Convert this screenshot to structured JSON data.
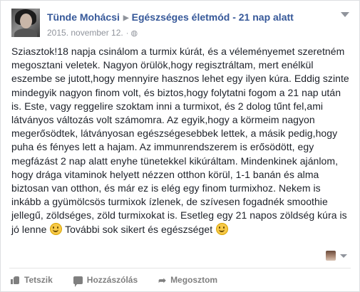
{
  "post": {
    "author": "Tünde Mohácsi",
    "target": "Egészséges életmód - 21 nap alatt",
    "date": "2015. november 12.",
    "privacy_icon": "globe-icon",
    "text_lines": [
      "Sziasztok!18 napja csinálom a turmix kúrát, és a véleményemet szeretném",
      "megosztani veletek. Nagyon örülök,hogy regisztráltam, mert enélkül",
      "eszembe se jutott,hogy mennyire hasznos lehet egy ilyen kúra. Eddig szinte",
      "mindegyik nagyon finom volt, és biztos,hogy folytatni fogom a 21 nap után",
      "is. Este, vagy reggelire szoktam inni a turmixot, és 2 dolog tűnt fel,ami",
      "látványos változás volt számomra. Az egyik,hogy a körmeim nagyon",
      "megerősödtek, látványosan egészségesebbek lettek, a másik pedig,hogy",
      "puha és fényes lett a hajam. Az immunrendszerem is erősödött, egy",
      "megfázást 2 nap alatt enyhe tünetekkel kikúráltam. Mindenkinek ajánlom,",
      "hogy drága vitaminok helyett nézzen otthon körül, 1-1 banán és alma",
      "biztosan van otthon, és már ez is elég egy finom turmixhoz. Nekem is",
      "inkább a gyümölcsös turmixok ízlenek, de szívesen fogadnék smoothie",
      "jellegű, zöldséges, zöld turmixokat is. Esetleg egy 21 napos zöldség kúra is"
    ],
    "last_line_a": "jó lenne",
    "last_line_b": " További sok sikert és egészséget"
  },
  "actions": {
    "like": "Tetszik",
    "comment": "Hozzászólás",
    "share": "Megosztom"
  },
  "colors": {
    "link": "#365899",
    "meta": "#90949c",
    "text": "#1d2129"
  }
}
